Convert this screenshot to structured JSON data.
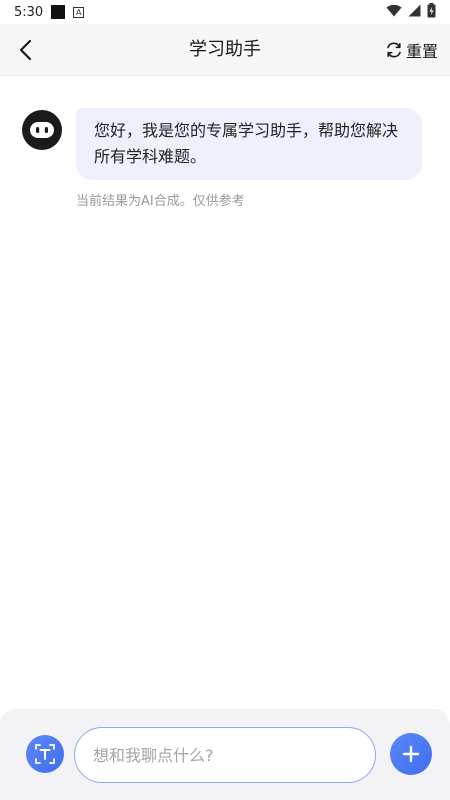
{
  "status_bar": {
    "time": "5:30",
    "indicator_a": "A"
  },
  "header": {
    "title": "学习助手",
    "reset_label": "重置"
  },
  "chat": {
    "messages": [
      {
        "role": "assistant",
        "text": "您好，我是您的专属学习助手，帮助您解决所有学科难题。"
      }
    ],
    "ai_note": "当前结果为AI合成。仅供参考"
  },
  "input_bar": {
    "placeholder": "想和我聊点什么?",
    "value": ""
  },
  "colors": {
    "accent": "#3e6ef0",
    "bubble_bg": "#eef0fb",
    "header_bg": "#f7f7f8"
  }
}
